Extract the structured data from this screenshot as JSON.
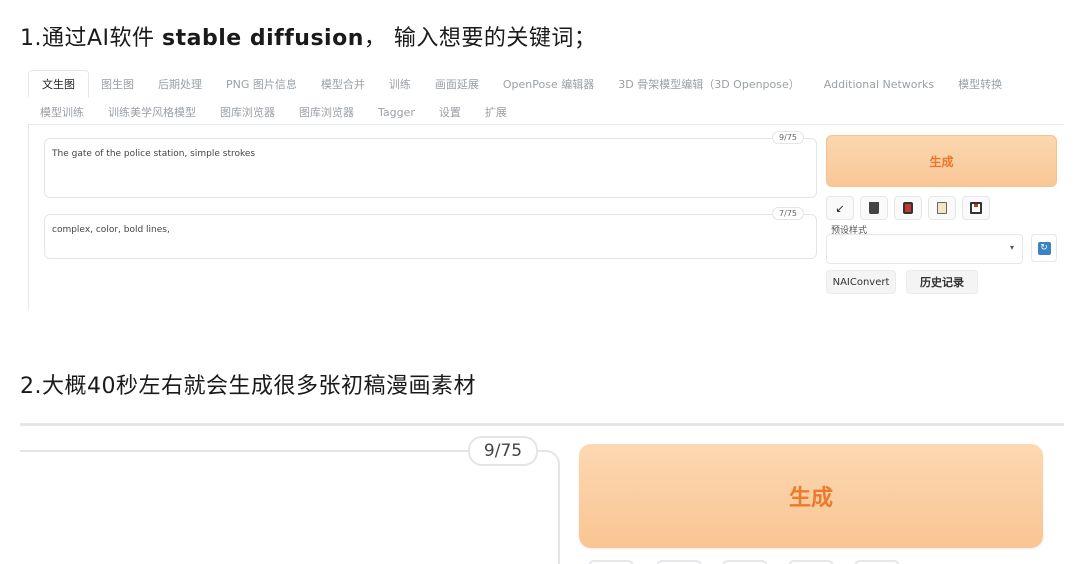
{
  "step1": {
    "prefix": "1.通过AI软件 ",
    "bold": "stable diffusion",
    "suffix": "， 输入想要的关键词；"
  },
  "step2": {
    "text": "2.大概40秒左右就会生成很多张初稿漫画素材"
  },
  "tabs_row1": [
    "文生图",
    "图生图",
    "后期处理",
    "PNG 图片信息",
    "模型合并",
    "训练",
    "画面延展",
    "OpenPose 编辑器",
    "3D 骨架模型编辑（3D Openpose）",
    "Additional Networks",
    "模型转换"
  ],
  "tabs_row2": [
    "模型训练",
    "训练美学风格模型",
    "图库浏览器",
    "图库浏览器",
    "Tagger",
    "设置",
    "扩展"
  ],
  "prompt": {
    "text": "The gate of the police station, simple strokes",
    "count": "9/75"
  },
  "negative_prompt": {
    "text": "complex, color, bold lines,",
    "count": "7/75"
  },
  "generate_label": "生成",
  "preset": {
    "label": "预设样式",
    "caret": "▾",
    "value": ""
  },
  "buttons": {
    "nai_convert": "NAIConvert",
    "history": "历史记录"
  },
  "icons": {
    "tool1": "arrow-icon",
    "tool2": "trash-icon",
    "tool3": "red-card-icon",
    "tool4": "clipboard-icon",
    "tool5": "save-icon",
    "refresh": "refresh-icon",
    "refresh_glyph": "↻",
    "arrow_glyph": "↙"
  },
  "zoom": {
    "count": "9/75",
    "generate_label": "生成"
  },
  "colors": {
    "accent_orange": "#ec7a2c",
    "button_bg": "#f9c796",
    "refresh_blue": "#3b82c4"
  }
}
